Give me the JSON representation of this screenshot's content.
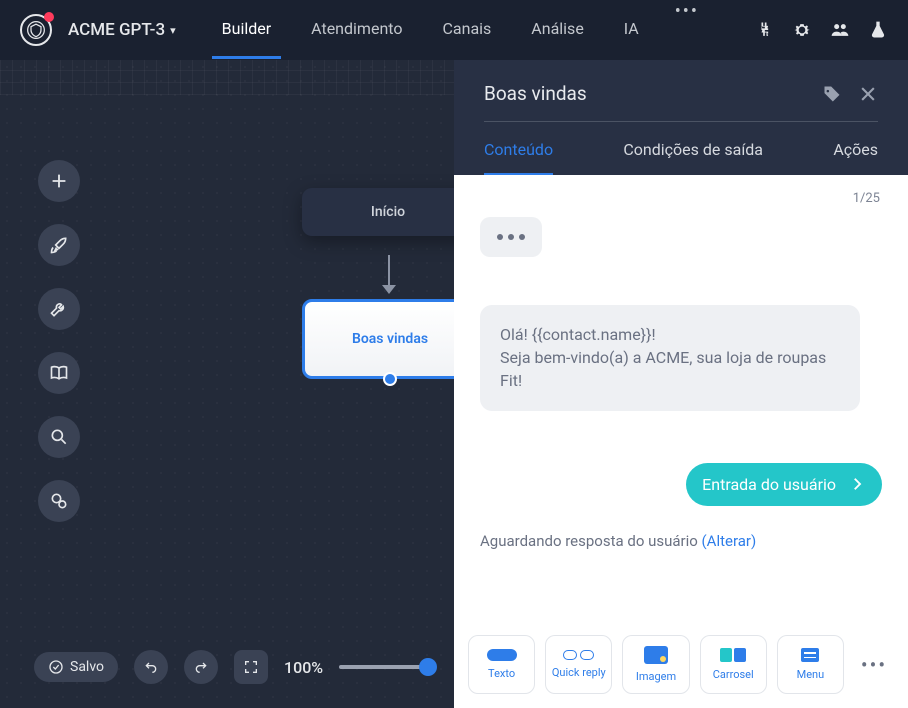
{
  "project_name": "ACME GPT-3",
  "nav": {
    "tabs": [
      "Builder",
      "Atendimento",
      "Canais",
      "Análise",
      "IA"
    ],
    "active_index": 0
  },
  "canvas": {
    "start_node_label": "Início",
    "welcome_node_label": "Boas vindas"
  },
  "bottom": {
    "saved_label": "Salvo",
    "zoom_label": "100%"
  },
  "panel": {
    "title": "Boas vindas",
    "tabs": [
      "Conteúdo",
      "Condições de saída",
      "Ações"
    ],
    "active_tab_index": 0,
    "counter": "1/25",
    "message_text": "Olá! {{contact.name}}!\nSeja bem-vindo(a) a ACME, sua loja de roupas Fit!",
    "user_input_label": "Entrada do usuário",
    "waiting_text": "Aguardando resposta do usuário ",
    "waiting_link": "(Alterar)",
    "tool_cards": [
      {
        "label": "Texto"
      },
      {
        "label": "Quick reply"
      },
      {
        "label": "Imagem"
      },
      {
        "label": "Carrosel"
      },
      {
        "label": "Menu"
      }
    ]
  }
}
